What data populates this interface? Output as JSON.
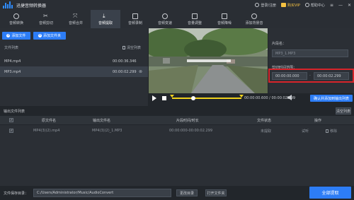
{
  "app": {
    "title": "迅捷音频转换器"
  },
  "titlebar": {
    "login": "登录/注册",
    "vip": "购买VIP",
    "help": "帮助中心"
  },
  "toolbar": [
    "音频转换",
    "音频剪切",
    "音频合并",
    "音频提取",
    "音频录制",
    "音频变速",
    "音量调整",
    "音频降噪",
    "添加背景音"
  ],
  "left": {
    "add_file": "添加文件",
    "add_folder": "添加文件夹",
    "list_title": "文件列表",
    "clear_list": "清空列表",
    "files": [
      {
        "name": "MP4.mp4",
        "duration": "00:00:36.346"
      },
      {
        "name": "MP3.mp4",
        "duration": "00:00:02.299"
      }
    ]
  },
  "player": {
    "current": "00:00:00.600",
    "total": "00:00:02.299",
    "add_output": "确认并添加到输出列表"
  },
  "right": {
    "clip_name_label": "片段名：",
    "clip_name_value": "MP3_1.MP3",
    "time_range_label": "剪切时间范围：",
    "start_time": "00:00:00.000",
    "end_time": "00:00:02.299"
  },
  "output": {
    "title": "输出文件列表",
    "clear": "清空列表",
    "columns": [
      "原文件名",
      "输出文件名",
      "片段时间/时长",
      "文件状态",
      "操作"
    ],
    "rows": [
      {
        "source": "MP4(3)(2).mp4",
        "output": "MP4(3)(2)_1.MP3",
        "time": "00:00:000-00:00:02.299",
        "status": "未提取",
        "preview": "试听",
        "remove": "移除"
      }
    ]
  },
  "footer": {
    "path_label": "文件保存目录：",
    "path_value": "C:/Users/Administrator/Music/AudioConvert",
    "change_dir": "更改目录",
    "open_folder": "打开文件夹",
    "extract_all": "全部提取"
  },
  "colors": {
    "accent": "#2d7df6",
    "highlight_box": "#d8242a",
    "range": "#f0d21e",
    "vip": "#f5c242"
  }
}
